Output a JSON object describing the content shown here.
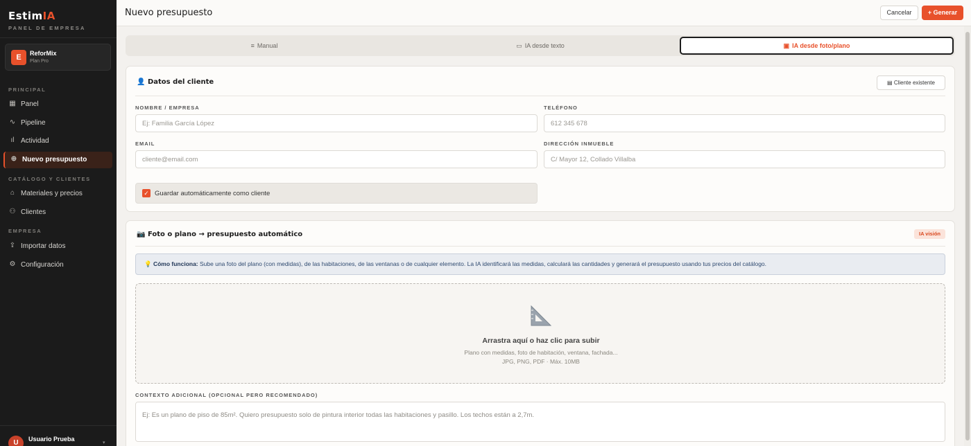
{
  "brand": {
    "name_main": "Estim",
    "name_accent": "IA",
    "subtitle": "PANEL DE EMPRESA"
  },
  "company": {
    "initial": "E",
    "name": "ReforMix",
    "plan": "Plan Pro"
  },
  "sidebar": {
    "sections": [
      {
        "label": "PRINCIPAL",
        "items": [
          {
            "label": "Panel",
            "icon": "grid-icon"
          },
          {
            "label": "Pipeline",
            "icon": "pulse-icon"
          },
          {
            "label": "Actividad",
            "icon": "bar-chart-icon"
          },
          {
            "label": "Nuevo presupuesto",
            "icon": "plus-circle-icon",
            "active": true
          }
        ]
      },
      {
        "label": "CATÁLOGO Y CLIENTES",
        "items": [
          {
            "label": "Materiales y precios",
            "icon": "home-icon"
          },
          {
            "label": "Clientes",
            "icon": "users-icon"
          }
        ]
      },
      {
        "label": "EMPRESA",
        "items": [
          {
            "label": "Importar datos",
            "icon": "upload-icon"
          },
          {
            "label": "Configuración",
            "icon": "gear-icon"
          }
        ]
      }
    ]
  },
  "user": {
    "initial": "U",
    "name": "Usuario Prueba"
  },
  "header": {
    "title": "Nuevo presupuesto",
    "cancel_label": "Cancelar",
    "generate_label": "+ Generar"
  },
  "tabs": [
    {
      "label": "Manual",
      "icon": "list-icon",
      "active": false
    },
    {
      "label": "IA desde texto",
      "icon": "chat-icon",
      "active": false
    },
    {
      "label": "IA desde foto/plano",
      "icon": "image-icon",
      "active": true
    }
  ],
  "client_card": {
    "title": "Datos del cliente",
    "existing_button": "Cliente existente",
    "fields": {
      "name": {
        "label": "NOMBRE / EMPRESA",
        "placeholder": "Ej: Familia García López"
      },
      "phone": {
        "label": "TELÉFONO",
        "placeholder": "612 345 678"
      },
      "email": {
        "label": "EMAIL",
        "placeholder": "cliente@email.com"
      },
      "address": {
        "label": "DIRECCIÓN INMUEBLE",
        "placeholder": "C/ Mayor 12, Collado Villalba"
      }
    },
    "save_checkbox": {
      "label": "Guardar automáticamente como cliente",
      "checked": true
    }
  },
  "photo_card": {
    "title": "Foto o plano → presupuesto automático",
    "badge": "IA visión",
    "info_bold": "Cómo funciona:",
    "info_text": " Sube una foto del plano (con medidas), de las habitaciones, de las ventanas o de cualquier elemento. La IA identificará las medidas, calculará las cantidades y generará el presupuesto usando tus precios del catálogo.",
    "dropzone": {
      "title": "Arrastra aquí o haz clic para subir",
      "subtitle": "Plano con medidas, foto de habitación, ventana, fachada...",
      "formats": "JPG, PNG, PDF · Máx. 10MB"
    },
    "context_label": "CONTEXTO ADICIONAL (OPCIONAL PERO RECOMENDADO)",
    "context_placeholder": "Ej: Es un plano de piso de 85m². Quiero presupuesto solo de pintura interior todas las habitaciones y pasillo. Los techos están a 2,7m.\n\nO: Es una foto de la ventana del salón. Necesito precio para cambiarla por aluminio con doble acristalamiento."
  },
  "colors": {
    "accent": "#e8512b",
    "sidebar_bg": "#1b1b1b",
    "info_bg": "#e9ecf1"
  }
}
